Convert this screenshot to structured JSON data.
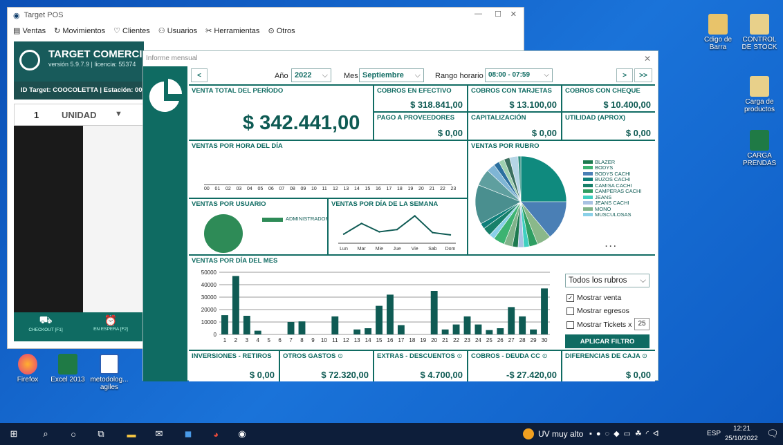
{
  "desktop": {
    "icons": [
      {
        "label": "Cdigo de Barra"
      },
      {
        "label": "CONTROL DE STOCK"
      },
      {
        "label": "Carga de productos"
      },
      {
        "label": "CARGA PRENDAS"
      },
      {
        "label": "Firefox"
      },
      {
        "label": "Excel 2013"
      },
      {
        "label": "metodolog... agiles"
      }
    ]
  },
  "pos": {
    "title": "Target POS",
    "menu": [
      "Ventas",
      "Movimientos",
      "Clientes",
      "Usuarios",
      "Herramientas",
      "Otros"
    ],
    "brand": "TARGET COMERCIO",
    "version": "versión 5.9.7.9  |  licencia: 55374",
    "target_id": "ID Target: COOCOLETTA | Estación: 00",
    "qty": "1",
    "unit": "UNIDAD",
    "btn_checkout": "CHECKOUT [F1]",
    "btn_espera": "EN ESPERA [F2]"
  },
  "report": {
    "title": "Informe mensual",
    "year_label": "Año",
    "year": "2022",
    "month_label": "Mes",
    "month": "Septiembre",
    "range_label": "Rango horario",
    "range": "08:00 - 07:59",
    "prev": "<",
    "next": ">",
    "next2": ">>",
    "venta_total_label": "VENTA TOTAL DEL PERÍODO",
    "venta_total": "$ 342.441,00",
    "efectivo_label": "COBROS EN EFECTIVO",
    "efectivo": "$ 318.841,00",
    "tarjetas_label": "COBROS CON TARJETAS",
    "tarjetas": "$ 13.100,00",
    "cheque_label": "COBROS CON CHEQUE",
    "cheque": "$ 10.400,00",
    "proveedores_label": "PAGO A PROVEEDORES",
    "proveedores": "$ 0,00",
    "capitalizacion_label": "CAPITALIZACIÓN",
    "capitalizacion": "$ 0,00",
    "utilidad_label": "UTILIDAD (APROX)",
    "utilidad": "$ 0,00",
    "hora_label": "VENTAS POR HORA DEL DÍA",
    "hours": [
      "00",
      "01",
      "02",
      "03",
      "04",
      "05",
      "06",
      "07",
      "08",
      "09",
      "10",
      "11",
      "12",
      "13",
      "14",
      "15",
      "16",
      "17",
      "18",
      "19",
      "20",
      "21",
      "22",
      "23"
    ],
    "rubro_label": "VENTAS POR RUBRO",
    "rubros": [
      "BLAZER",
      "BODYS",
      "BODYS CACHI",
      "BUZOS CACHI",
      "CAMISA CACHI",
      "CAMPERAS CACHI",
      "JEANS",
      "JEANS CACHI",
      "MONO",
      "MUSCULOSAS"
    ],
    "rubro_colors": [
      "#1d7a4f",
      "#3cb371",
      "#4a7fb5",
      "#0f7f7a",
      "#17806a",
      "#2e9e62",
      "#3fd0c0",
      "#a9c2e2",
      "#80b38a",
      "#8ad0e8"
    ],
    "rubro_more": ". . .",
    "usuario_label": "VENTAS POR USUARIO",
    "usuario_name": "ADMINISTRADOR",
    "semana_label": "VENTAS POR DÍA DE LA SEMANA",
    "mes_label": "VENTAS POR DÍA DEL MES",
    "filter_select": "Todos los rubros",
    "chk_venta": "Mostrar venta",
    "chk_egresos": "Mostrar egresos",
    "chk_tickets": "Mostrar Tickets x",
    "tickets_n": "25",
    "apply": "APLICAR FILTRO",
    "inversiones_label": "INVERSIONES - RETIROS",
    "inversiones": "$ 0,00",
    "gastos_label": "OTROS GASTOS",
    "gastos": "$ 72.320,00",
    "extras_label": "EXTRAS - DESCUENTOS",
    "extras": "$ 4.700,00",
    "deuda_label": "COBROS - DEUDA CC",
    "deuda": "-$ 27.420,00",
    "diferencias_label": "DIFERENCIAS DE CAJA",
    "diferencias": "$ 0,00"
  },
  "taskbar": {
    "weather": "UV muy alto",
    "lang": "ESP",
    "time": "12:21",
    "date": "25/10/2022"
  },
  "chart_data": [
    {
      "type": "bar",
      "title": "VENTAS POR DÍA DEL MES",
      "categories": [
        "1",
        "2",
        "3",
        "4",
        "5",
        "6",
        "7",
        "8",
        "9",
        "10",
        "11",
        "12",
        "13",
        "14",
        "15",
        "16",
        "17",
        "18",
        "19",
        "20",
        "21",
        "22",
        "23",
        "24",
        "25",
        "26",
        "27",
        "28",
        "29",
        "30"
      ],
      "values": [
        15500,
        47000,
        15000,
        3000,
        0,
        0,
        10000,
        10500,
        0,
        0,
        14500,
        0,
        4000,
        5000,
        23000,
        32000,
        7500,
        0,
        0,
        35000,
        4000,
        8000,
        14500,
        8000,
        3500,
        5000,
        22000,
        14500,
        4000,
        37000
      ],
      "ylim": [
        0,
        50000
      ],
      "yticks": [
        0,
        10000,
        20000,
        30000,
        40000,
        50000
      ]
    },
    {
      "type": "line",
      "title": "VENTAS POR DÍA DE LA SEMANA",
      "categories": [
        "Lun",
        "Mar",
        "Mie",
        "Jue",
        "Vie",
        "Sab",
        "Dom"
      ],
      "values": [
        60000,
        130000,
        75000,
        90000,
        180000,
        70000,
        55000
      ]
    },
    {
      "type": "pie",
      "title": "VENTAS POR USUARIO",
      "categories": [
        "ADMINISTRADOR"
      ],
      "values": [
        342441
      ]
    },
    {
      "type": "pie",
      "title": "VENTAS POR RUBRO",
      "values": [
        25,
        14,
        5,
        3,
        2,
        2,
        2,
        3,
        4,
        2,
        3,
        2,
        14,
        6,
        3,
        2,
        2,
        2,
        3,
        1
      ]
    }
  ]
}
